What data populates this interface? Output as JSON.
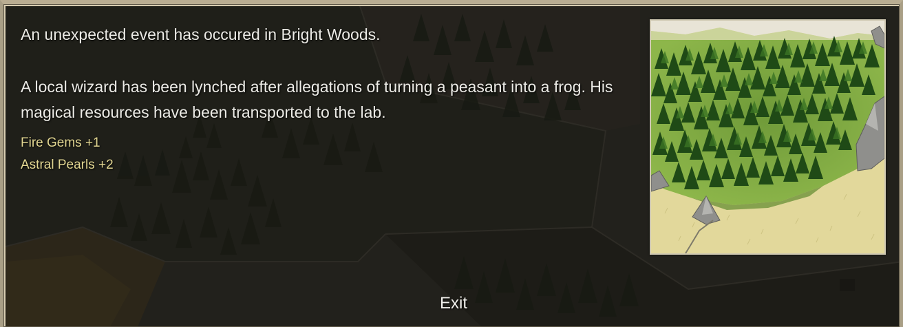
{
  "event_dialog": {
    "title_text": "An unexpected event has occured in Bright Woods.",
    "body_lines": [
      "A local wizard has been lynched after allegations of turning a peasant into a frog. His",
      "magical resources have been transported to the lab."
    ],
    "rewards": [
      "Fire Gems +1",
      "Astral Pearls +2"
    ],
    "exit_label": "Exit",
    "image": "bright-woods-forest-province-illustration"
  },
  "colors": {
    "text": "#ecebe6",
    "reward_text": "#e2d691",
    "frame": "#b9ad92",
    "forest_dark": "#1f4a16",
    "meadow": "#e4da9f"
  }
}
